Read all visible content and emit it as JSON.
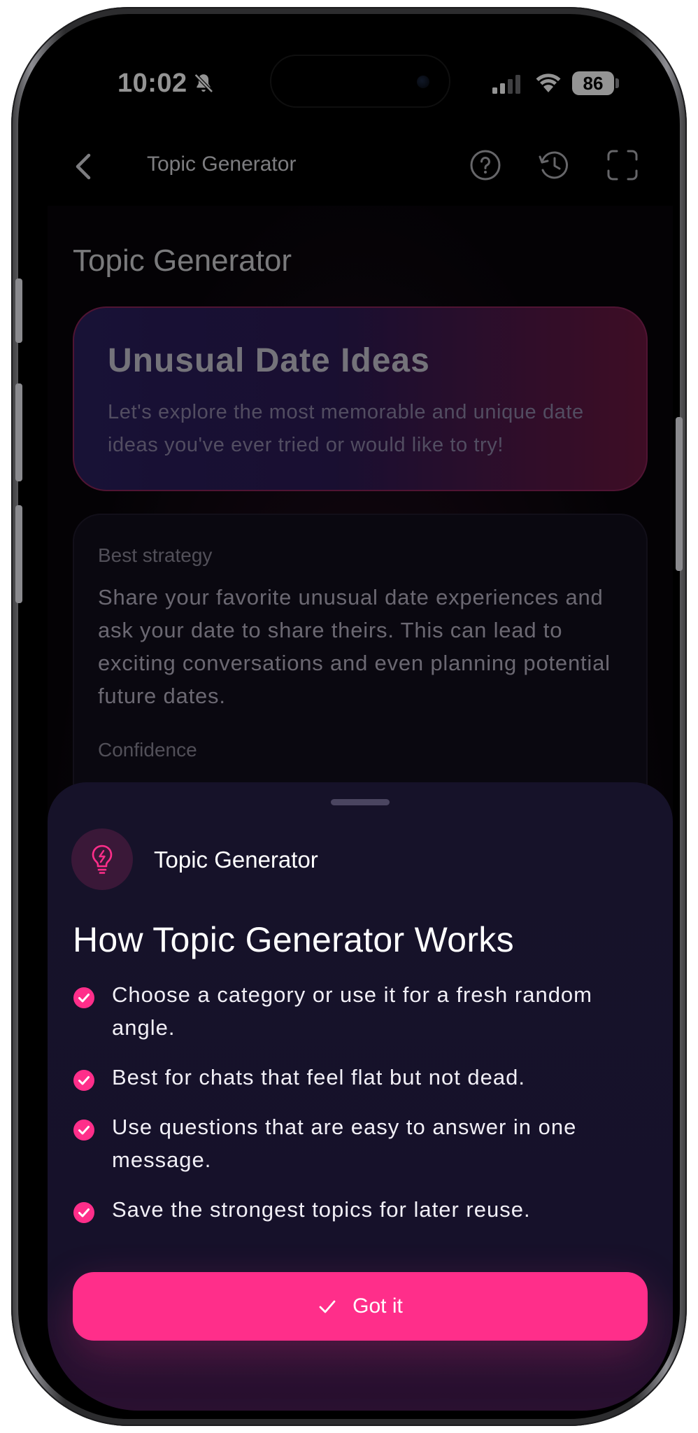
{
  "status_bar": {
    "time": "10:02",
    "battery": "86"
  },
  "nav": {
    "title": "Topic Generator"
  },
  "page": {
    "title": "Topic Generator",
    "topic_card": {
      "title": "Unusual Date Ideas",
      "description": "Let's explore the most memorable and unique date ideas you've ever tried or would like to try!"
    },
    "strategy_card": {
      "label": "Best strategy",
      "text": "Share your favorite unusual date experiences and ask your date to share theirs. This can lead to exciting conversations and even planning potential future dates.",
      "confidence_label": "Confidence"
    }
  },
  "sheet": {
    "badge_label": "Topic Generator",
    "title": "How Topic Generator Works",
    "bullets": [
      "Choose a category or use it for a fresh random angle.",
      "Best for chats that feel flat but not dead.",
      "Use questions that are easy to answer in one message.",
      "Save the strongest topics for later reuse."
    ],
    "button_label": "Got it"
  },
  "icons": {
    "status": [
      "bell-slash-icon",
      "signal-icon",
      "wifi-icon",
      "battery-icon"
    ],
    "nav": [
      "back-chevron-icon",
      "help-icon",
      "history-icon",
      "expand-icon"
    ],
    "sheet": [
      "lightbulb-icon",
      "check-circle-icon",
      "checkmark-icon"
    ]
  },
  "colors": {
    "accent": "#ff2e8a",
    "sheet_bg": "#161229",
    "badge_bg": "#3a1838"
  }
}
